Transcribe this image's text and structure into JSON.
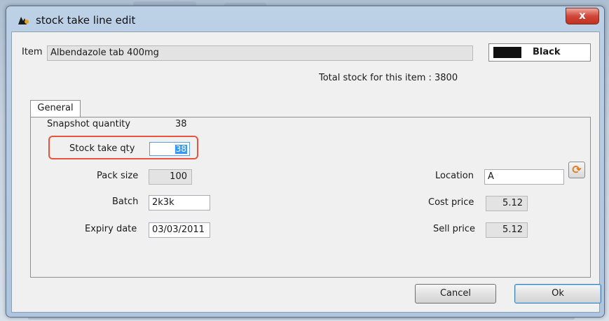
{
  "window": {
    "title": "stock take line edit",
    "close_symbol": "x"
  },
  "item": {
    "label": "Item",
    "value": "Albendazole tab 400mg",
    "color_name": "Black",
    "color_hex": "#111111",
    "total_stock_text": "Total stock for this item : 3800"
  },
  "tabs": [
    {
      "label": "General"
    }
  ],
  "general": {
    "snapshot_label": "Snapshot quantity",
    "snapshot_value": "38",
    "stock_take_label": "Stock take qty",
    "stock_take_value": "38",
    "pack_size_label": "Pack size",
    "pack_size_value": "100",
    "batch_label": "Batch",
    "batch_value": "2k3k",
    "expiry_label": "Expiry date",
    "expiry_value": "03/03/2011",
    "location_label": "Location",
    "location_value": "A",
    "cost_price_label": "Cost price",
    "cost_price_value": "5.12",
    "sell_price_label": "Sell price",
    "sell_price_value": "5.12"
  },
  "buttons": {
    "cancel": "Cancel",
    "ok": "Ok"
  },
  "colors": {
    "highlight": "#e8543f",
    "selection": "#3399ff"
  },
  "icons": {
    "app": "app-logo-icon",
    "refresh": "refresh-icon"
  }
}
